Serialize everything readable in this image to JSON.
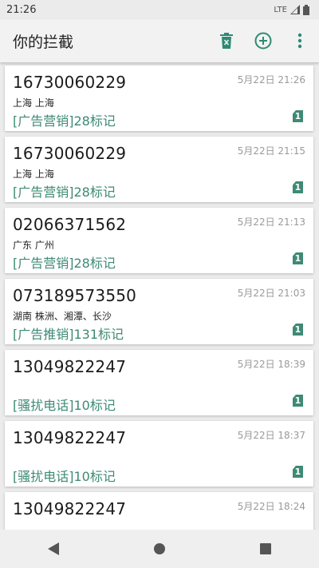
{
  "status_bar": {
    "time": "21:26",
    "network": "LTE"
  },
  "app_bar": {
    "title": "你的拦截"
  },
  "colors": {
    "accent": "#3e8a74",
    "icon": "#2e8a72"
  },
  "calls": [
    {
      "number": "16730060229",
      "time": "5月22日 21:26",
      "location": "上海 上海",
      "tag": "[广告营销]28标记",
      "count": "1"
    },
    {
      "number": "16730060229",
      "time": "5月22日 21:15",
      "location": "上海 上海",
      "tag": "[广告营销]28标记",
      "count": "1"
    },
    {
      "number": "02066371562",
      "time": "5月22日 21:13",
      "location": "广东 广州",
      "tag": "[广告营销]28标记",
      "count": "1"
    },
    {
      "number": "073189573550",
      "time": "5月22日 21:03",
      "location": "湖南 株洲、湘潭、长沙",
      "tag": "[广告推销]131标记",
      "count": "1"
    },
    {
      "number": "13049822247",
      "time": "5月22日 18:39",
      "location": "",
      "tag": "[骚扰电话]10标记",
      "count": "1"
    },
    {
      "number": "13049822247",
      "time": "5月22日 18:37",
      "location": "",
      "tag": "[骚扰电话]10标记",
      "count": "1"
    },
    {
      "number": "13049822247",
      "time": "5月22日 18:24",
      "location": "",
      "tag": "",
      "count": ""
    }
  ],
  "icons": {
    "delete": "trash-icon",
    "add": "add-circle-icon",
    "more": "more-vert-icon",
    "back": "back-triangle-icon",
    "home": "home-circle-icon",
    "recents": "recents-square-icon"
  }
}
